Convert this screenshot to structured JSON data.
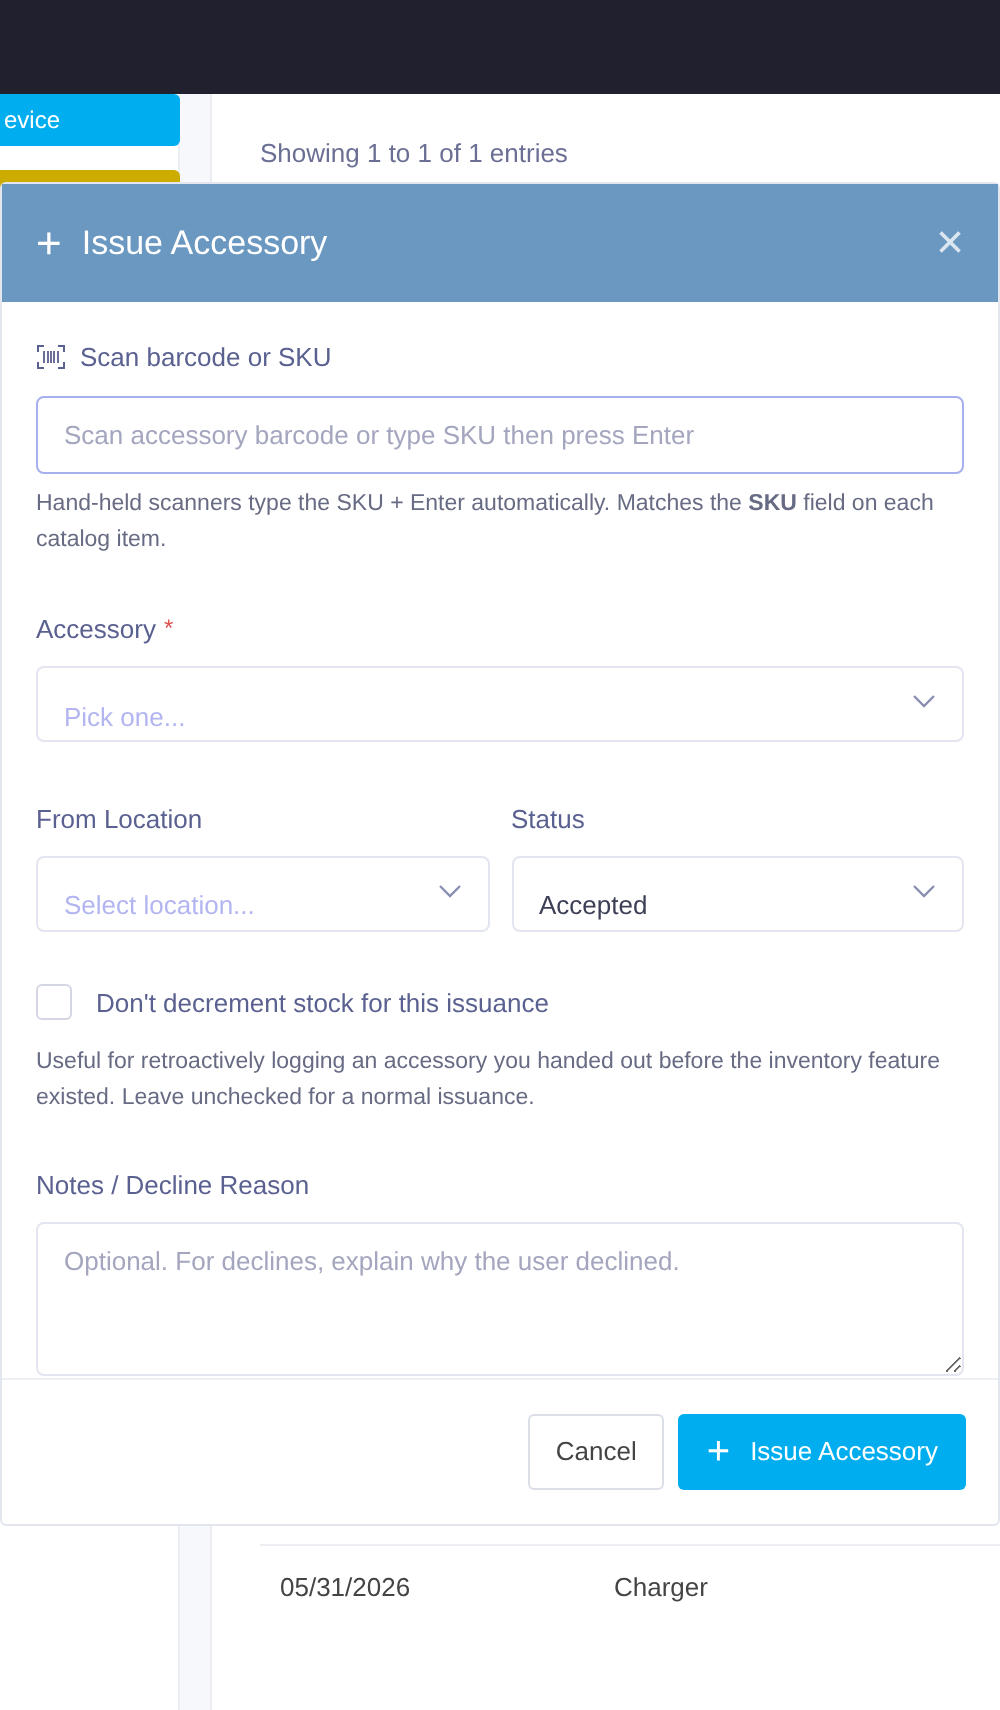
{
  "background": {
    "sidebar_buttons": [
      {
        "label": "evice",
        "color": "#00aeef"
      },
      {
        "color": "#cdac00"
      }
    ],
    "entries_info": "Showing 1 to 1 of 1 entries",
    "table_rows": [
      {
        "date": "05/31/2026",
        "item": "Charger"
      }
    ]
  },
  "modal": {
    "title_icon": "+",
    "title": "Issue Accessory",
    "close": "×",
    "scan": {
      "label": "Scan barcode or SKU",
      "placeholder": "Scan accessory barcode or type SKU then press Enter",
      "help": "Hand-held scanners type the SKU + Enter automatically. Matches the **SKU** field on each catalog item."
    },
    "accessory": {
      "label": "Accessory",
      "required_mark": "*",
      "placeholder": "Pick one..."
    },
    "from_location": {
      "label": "From Location",
      "placeholder": "Select location..."
    },
    "status": {
      "label": "Status",
      "value": "Accepted"
    },
    "no_decrement": {
      "label": "Don't decrement stock for this issuance",
      "checked": false,
      "help": "Useful for retroactively logging an accessory you handed out before the inventory feature existed. Leave unchecked for a normal issuance."
    },
    "notes": {
      "label": "Notes / Decline Reason",
      "placeholder": "Optional. For declines, explain why the user declined."
    },
    "buttons": {
      "cancel": "Cancel",
      "submit_icon": "+",
      "submit": "Issue Accessory"
    }
  }
}
